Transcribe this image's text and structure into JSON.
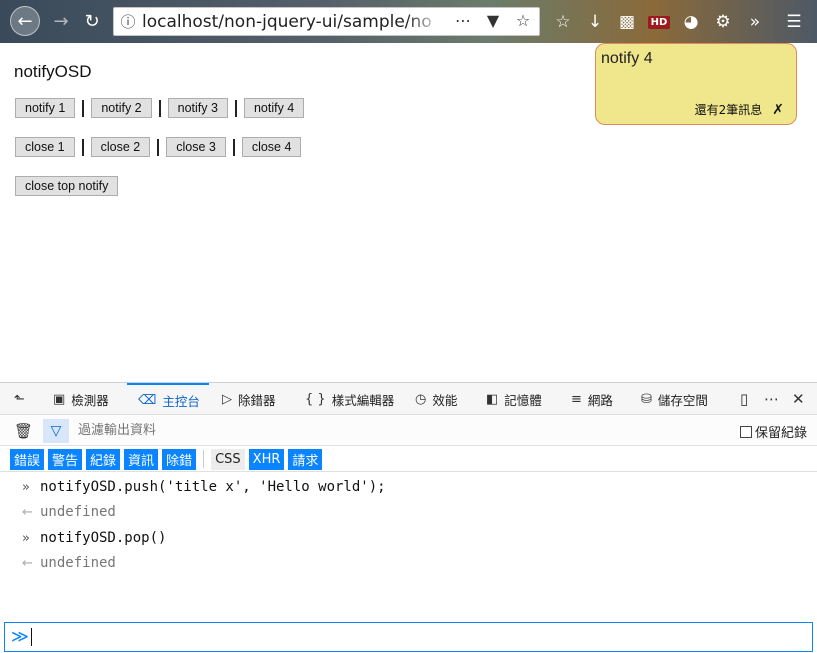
{
  "browser": {
    "url": "localhost/non-jquery-ui/sample/no",
    "icons": [
      "back-icon",
      "forward-icon",
      "reload-icon",
      "info-icon",
      "more-icon",
      "pocket-icon",
      "star-icon",
      "library-icon",
      "download-icon",
      "extension-icon",
      "hd-icon",
      "extension-circle-icon",
      "extension-gear-icon",
      "overflow-icon",
      "menu-icon"
    ],
    "hd_label": "HD"
  },
  "page": {
    "title": "notifyOSD",
    "notify_buttons": [
      "notify 1",
      "notify 2",
      "notify 3",
      "notify 4"
    ],
    "close_buttons": [
      "close 1",
      "close 2",
      "close 3",
      "close 4"
    ],
    "close_top_label": "close top notify"
  },
  "notification": {
    "title": "notify 4",
    "remaining": "還有2筆訊息",
    "close": "✗",
    "colors": {
      "background": "#f0e68c",
      "border": "#e08a60"
    }
  },
  "devtools": {
    "tabs": [
      {
        "label": "檢測器",
        "icon": "inspector-icon"
      },
      {
        "label": "主控台",
        "icon": "console-icon",
        "active": true
      },
      {
        "label": "除錯器",
        "icon": "debugger-icon"
      },
      {
        "label": "樣式編輯器",
        "icon": "style-editor-icon"
      },
      {
        "label": "效能",
        "icon": "performance-icon"
      },
      {
        "label": "記憶體",
        "icon": "memory-icon"
      },
      {
        "label": "網路",
        "icon": "network-icon"
      },
      {
        "label": "儲存空間",
        "icon": "storage-icon"
      }
    ],
    "filter_placeholder": "過濾輸出資料",
    "persist_label": "保留紀錄",
    "categories_on": [
      "錯誤",
      "警告",
      "紀錄",
      "資訊",
      "除錯"
    ],
    "categories_mixed": [
      {
        "label": "CSS",
        "on": false
      },
      {
        "label": "XHR",
        "on": true
      },
      {
        "label": "請求",
        "on": true
      }
    ],
    "console_lines": [
      {
        "type": "input",
        "prefix": "»",
        "text": "notifyOSD.push('title x', 'Hello world');"
      },
      {
        "type": "result",
        "prefix": "←",
        "text": "undefined"
      },
      {
        "type": "input",
        "prefix": "»",
        "text": "notifyOSD.pop()"
      },
      {
        "type": "result",
        "prefix": "←",
        "text": "undefined"
      }
    ],
    "prompt_symbol": "≫",
    "accent": "#0a84ff"
  }
}
